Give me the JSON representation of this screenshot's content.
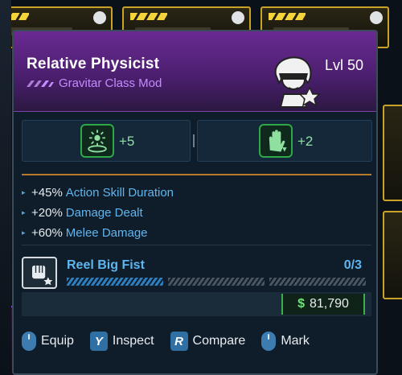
{
  "card": {
    "item_name": "Relative Physicist",
    "item_type": "Gravitar Class Mod",
    "level": "Lvl 50",
    "rarity_color": "#8d4bd6",
    "rarity_icon": "rarity-chevrons-icon",
    "portrait_icon": "gravitar-portrait-icon"
  },
  "skill_bonuses": [
    {
      "icon": "orbital-skill-icon",
      "value": "+5"
    },
    {
      "icon": "glove-skill-icon",
      "value": "+2"
    }
  ],
  "perks": [
    {
      "value": "+45%",
      "label": "Action Skill Duration"
    },
    {
      "value": "+20%",
      "label": "Damage Dealt"
    },
    {
      "value": "+60%",
      "label": "Melee Damage"
    }
  ],
  "skill_rank": {
    "icon": "fist-icon",
    "name": "Reel Big Fist",
    "count": "0/3",
    "ranks_filled": 1,
    "ranks_total": 3
  },
  "price": {
    "currency_symbol": "$",
    "amount": "81,790"
  },
  "actions": [
    {
      "key": "",
      "key_icon": "mouse-left-icon",
      "label": "Equip"
    },
    {
      "key": "Y",
      "label": "Inspect"
    },
    {
      "key": "R",
      "label": "Compare"
    },
    {
      "key": "",
      "key_icon": "mouse-middle-icon",
      "label": "Mark"
    }
  ],
  "colors": {
    "header": "#5b2582",
    "accent_blue": "#5fb6ef",
    "skill_green": "#2fa84a",
    "price_green": "#3fae52",
    "separator_orange": "#b87a2a"
  }
}
